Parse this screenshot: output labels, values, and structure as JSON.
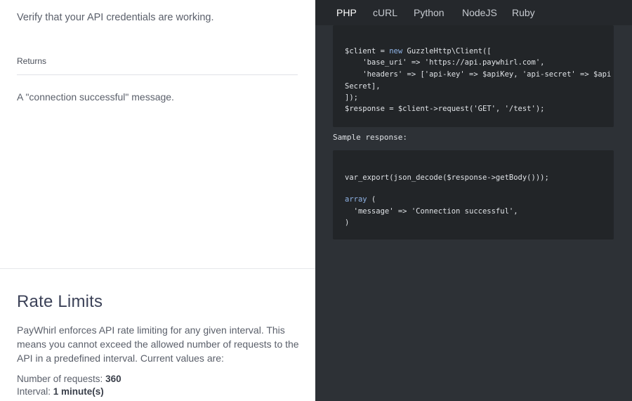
{
  "left": {
    "intro": "Verify that your API credentials are working.",
    "returns_label": "Returns",
    "returns_text": "A \"connection successful\" message.",
    "rate_limits": {
      "title": "Rate Limits",
      "description": "PayWhirl enforces API rate limiting for any given interval. This means you cannot exceed the allowed number of requests to the API in a predefined interval. Current values are:",
      "requests_label": "Number of requests: ",
      "requests_value": "360",
      "interval_label": "Interval: ",
      "interval_value": "1 minute(s)"
    }
  },
  "right": {
    "tabs": [
      {
        "label": "PHP",
        "active": true
      },
      {
        "label": "cURL",
        "active": false
      },
      {
        "label": "Python",
        "active": false
      },
      {
        "label": "NodeJS",
        "active": false
      },
      {
        "label": "Ruby",
        "active": false
      }
    ],
    "code_request": {
      "l1_a": "$client = ",
      "l1_kw": "new",
      "l1_b": " GuzzleHttp\\Client([",
      "l2": "    'base_uri' => 'https://api.paywhirl.com',",
      "l3": "    'headers' => ['api-key' => $apiKey, 'api-secret' => $api",
      "l4": "Secret],",
      "l5": "]);",
      "l6": "$response = $client->request('GET', '/test');"
    },
    "sample_label": "Sample response:",
    "code_response": {
      "l1": "var_export(json_decode($response->getBody()));",
      "l2_kw": "array",
      "l2_b": " (",
      "l3": "  'message' => 'Connection successful',",
      "l4": ")"
    }
  },
  "colors": {
    "code_panel_bg": "#2d3136",
    "tabbar_bg": "#25282c",
    "code_box_bg": "#222528",
    "keyword": "#8fb3e6",
    "heading": "#3c4258"
  }
}
